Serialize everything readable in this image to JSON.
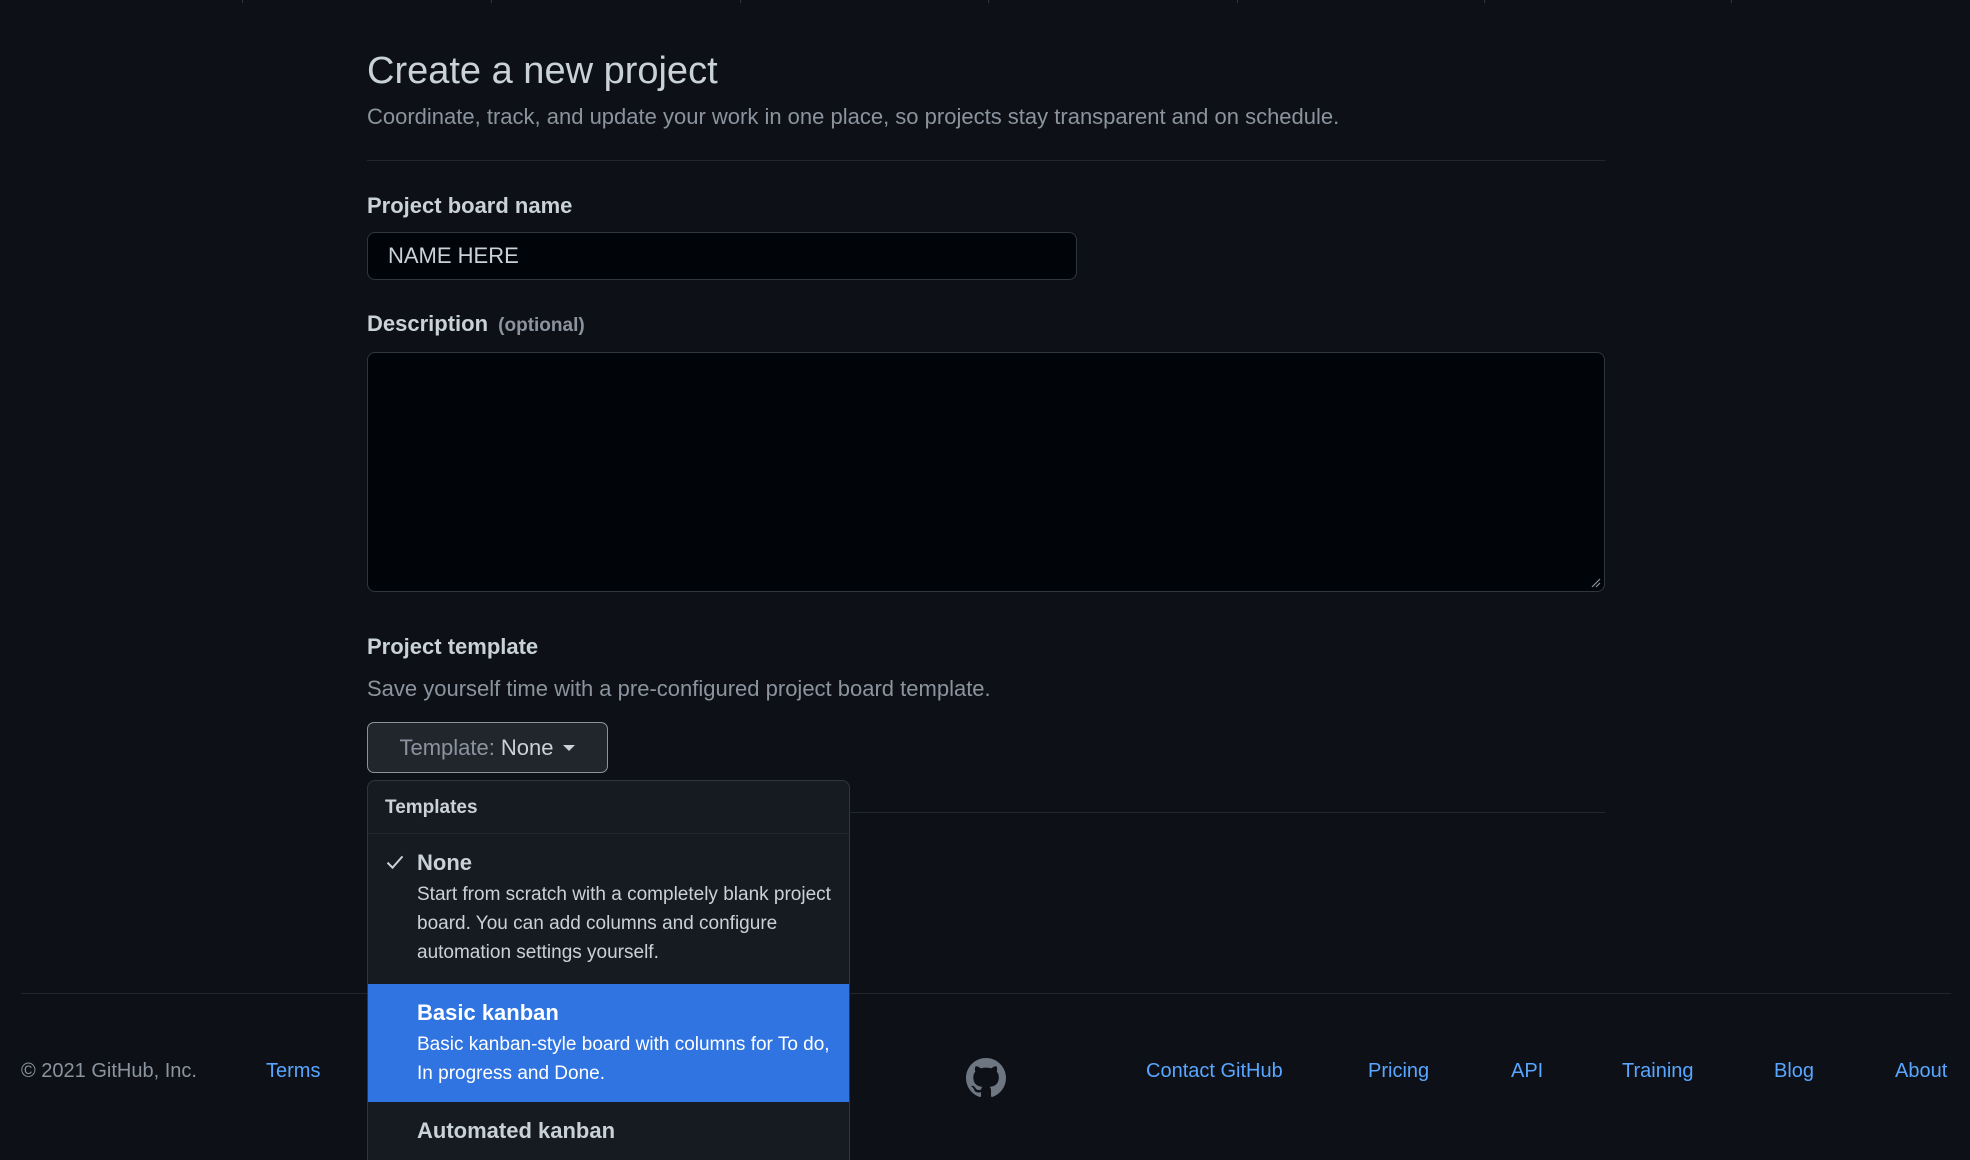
{
  "header": {
    "title": "Create a new project",
    "subtitle": "Coordinate, track, and update your work in one place, so projects stay transparent and on schedule."
  },
  "form": {
    "name_label": "Project board name",
    "name_value": "NAME HERE",
    "description_label": "Description",
    "description_optional": "(optional)",
    "description_value": "",
    "template_label": "Project template",
    "template_help": "Save yourself time with a pre-configured project board template.",
    "template_button_prefix": "Template:",
    "template_button_value": "None"
  },
  "dropdown": {
    "header": "Templates",
    "items": [
      {
        "title": "None",
        "description": "Start from scratch with a completely blank project board. You can add columns and configure automation settings yourself.",
        "selected": true,
        "highlighted": false
      },
      {
        "title": "Basic kanban",
        "description": "Basic kanban-style board with columns for To do, In progress and Done.",
        "selected": false,
        "highlighted": true
      },
      {
        "title": "Automated kanban",
        "description": "",
        "selected": false,
        "highlighted": false
      }
    ]
  },
  "footer": {
    "copyright": "© 2021 GitHub, Inc.",
    "links_left": [
      "Terms"
    ],
    "links_right": [
      "Contact GitHub",
      "Pricing",
      "API",
      "Training",
      "Blog",
      "About"
    ],
    "logo_icon": "github-octocat-icon"
  },
  "colors": {
    "background": "#0d1117",
    "highlight": "#2f74e0",
    "link": "#58a6ff"
  }
}
